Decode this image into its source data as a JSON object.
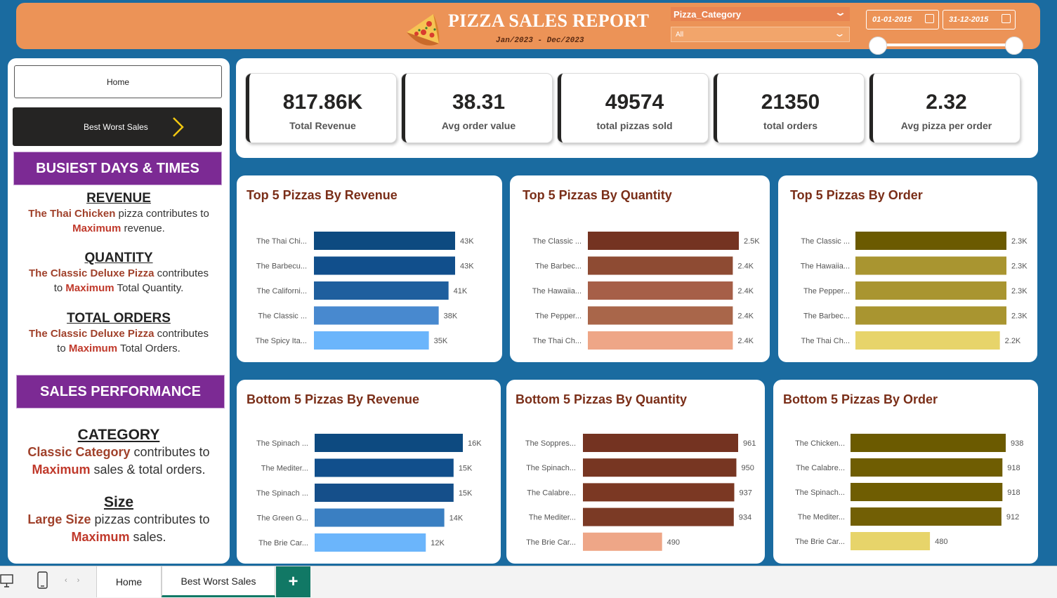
{
  "header": {
    "title": "PIZZA SALES REPORT",
    "period": "Jan/2023  -  Dec/2023",
    "slicer_label": "Pizza_Category",
    "slicer_value": "All",
    "date_start": "01-01-2015",
    "date_end": "31-12-2015"
  },
  "nav": {
    "home_label": "Home",
    "bestworst_label": "Best Worst Sales"
  },
  "insights": {
    "busiest_banner": "BUSIEST DAYS & TIMES",
    "revenue_heading": "REVENUE",
    "revenue_item": "The Thai Chicken",
    "revenue_text": " pizza contributes to",
    "revenue_max": "Maximum",
    "revenue_tail": " revenue.",
    "quantity_heading": "QUANTITY",
    "quantity_item": "The Classic Deluxe Pizza",
    "quantity_text": "  contributes",
    "quantity_to": "to ",
    "quantity_max": "Maximum",
    "quantity_tail": " Total Quantity.",
    "orders_heading": "TOTAL ORDERS",
    "orders_item": "The Classic Deluxe Pizza",
    "orders_text": "  contributes",
    "orders_to": "to ",
    "orders_max": "Maximum",
    "orders_tail": " Total Orders.",
    "sales_banner": "SALES PERFORMANCE",
    "category_heading": "CATEGORY",
    "category_item": "Classic Category",
    "category_text": " contributes to",
    "category_max": "Maximum",
    "category_tail": " sales & total orders.",
    "size_heading": "Size",
    "size_item": "Large Size",
    "size_text": " pizzas contributes to",
    "size_max": "Maximum",
    "size_tail": " sales."
  },
  "kpis": [
    {
      "value": "817.86K",
      "label": "Total Revenue"
    },
    {
      "value": "38.31",
      "label": "Avg order value"
    },
    {
      "value": "49574",
      "label": "total pizzas sold"
    },
    {
      "value": "21350",
      "label": "total orders"
    },
    {
      "value": "2.32",
      "label": "Avg pizza per order"
    }
  ],
  "tabs": {
    "home": "Home",
    "best_worst": "Best Worst Sales",
    "add": "+"
  },
  "colors": {
    "header_bg": "#ec9357",
    "canvas_bg": "#1a6ba0",
    "banner_purple": "#7c2a94",
    "title_brown": "#7a2e18",
    "revenue_title": "#7a2e18",
    "accent_red": "#c0392b",
    "tab_green": "#117865"
  },
  "chart_data": [
    {
      "id": "top-revenue",
      "type": "bar",
      "title": "Top 5 Pizzas By Revenue",
      "categories": [
        "The Thai Chi...",
        "The Barbecu...",
        "The Californi...",
        "The Classic ...",
        "The Spicy Ita..."
      ],
      "values": [
        43,
        43,
        41,
        38,
        35
      ],
      "labels": [
        "43K",
        "43K",
        "41K",
        "38K",
        "35K"
      ],
      "colors": [
        "#0d4a80",
        "#114f8c",
        "#1f5f9e",
        "#4889cf",
        "#6bb5fb"
      ]
    },
    {
      "id": "top-quantity",
      "type": "bar",
      "title": "Top 5 Pizzas By Quantity",
      "categories": [
        "The Classic ...",
        "The Barbec...",
        "The Hawaiia...",
        "The Pepper...",
        "The Thai Ch..."
      ],
      "values": [
        2.5,
        2.4,
        2.4,
        2.4,
        2.4
      ],
      "labels": [
        "2.5K",
        "2.4K",
        "2.4K",
        "2.4K",
        "2.4K"
      ],
      "colors": [
        "#743321",
        "#8e4b33",
        "#a65f48",
        "#a9664a",
        "#eea687"
      ]
    },
    {
      "id": "top-order",
      "type": "bar",
      "title": "Top 5 Pizzas By Order",
      "categories": [
        "The Classic ...",
        "The Hawaiia...",
        "The Pepper...",
        "The Barbec...",
        "The Thai Ch..."
      ],
      "values": [
        2.3,
        2.3,
        2.3,
        2.3,
        2.2
      ],
      "labels": [
        "2.3K",
        "2.3K",
        "2.3K",
        "2.3K",
        "2.2K"
      ],
      "colors": [
        "#6b5a00",
        "#a99530",
        "#a99530",
        "#a99530",
        "#e7d46a"
      ]
    },
    {
      "id": "bottom-revenue",
      "type": "bar",
      "title": "Bottom 5 Pizzas By Revenue",
      "categories": [
        "The Spinach ...",
        "The Mediter...",
        "The Spinach ...",
        "The Green G...",
        "The Brie Car..."
      ],
      "values": [
        16,
        15,
        15,
        14,
        12
      ],
      "labels": [
        "16K",
        "15K",
        "15K",
        "14K",
        "12K"
      ],
      "colors": [
        "#0d4a80",
        "#114f8c",
        "#154f8a",
        "#3a7fc2",
        "#6bb5fb"
      ]
    },
    {
      "id": "bottom-quantity",
      "type": "bar",
      "title": "Bottom 5 Pizzas By Quantity",
      "categories": [
        "The Soppres...",
        "The Spinach...",
        "The Calabre...",
        "The Mediter...",
        "The Brie Car..."
      ],
      "values": [
        961,
        950,
        937,
        934,
        490
      ],
      "labels": [
        "961",
        "950",
        "937",
        "934",
        "490"
      ],
      "colors": [
        "#743321",
        "#773622",
        "#7b3823",
        "#7b3a25",
        "#eea687"
      ]
    },
    {
      "id": "bottom-order",
      "type": "bar",
      "title": "Bottom 5 Pizzas By Order",
      "categories": [
        "The Chicken...",
        "The Calabre...",
        "The Spinach...",
        "The Mediter...",
        "The Brie Car..."
      ],
      "values": [
        938,
        918,
        918,
        912,
        480
      ],
      "labels": [
        "938",
        "918",
        "918",
        "912",
        "480"
      ],
      "colors": [
        "#6b5a00",
        "#6f5d02",
        "#6f5d02",
        "#725f05",
        "#e7d46a"
      ]
    }
  ]
}
